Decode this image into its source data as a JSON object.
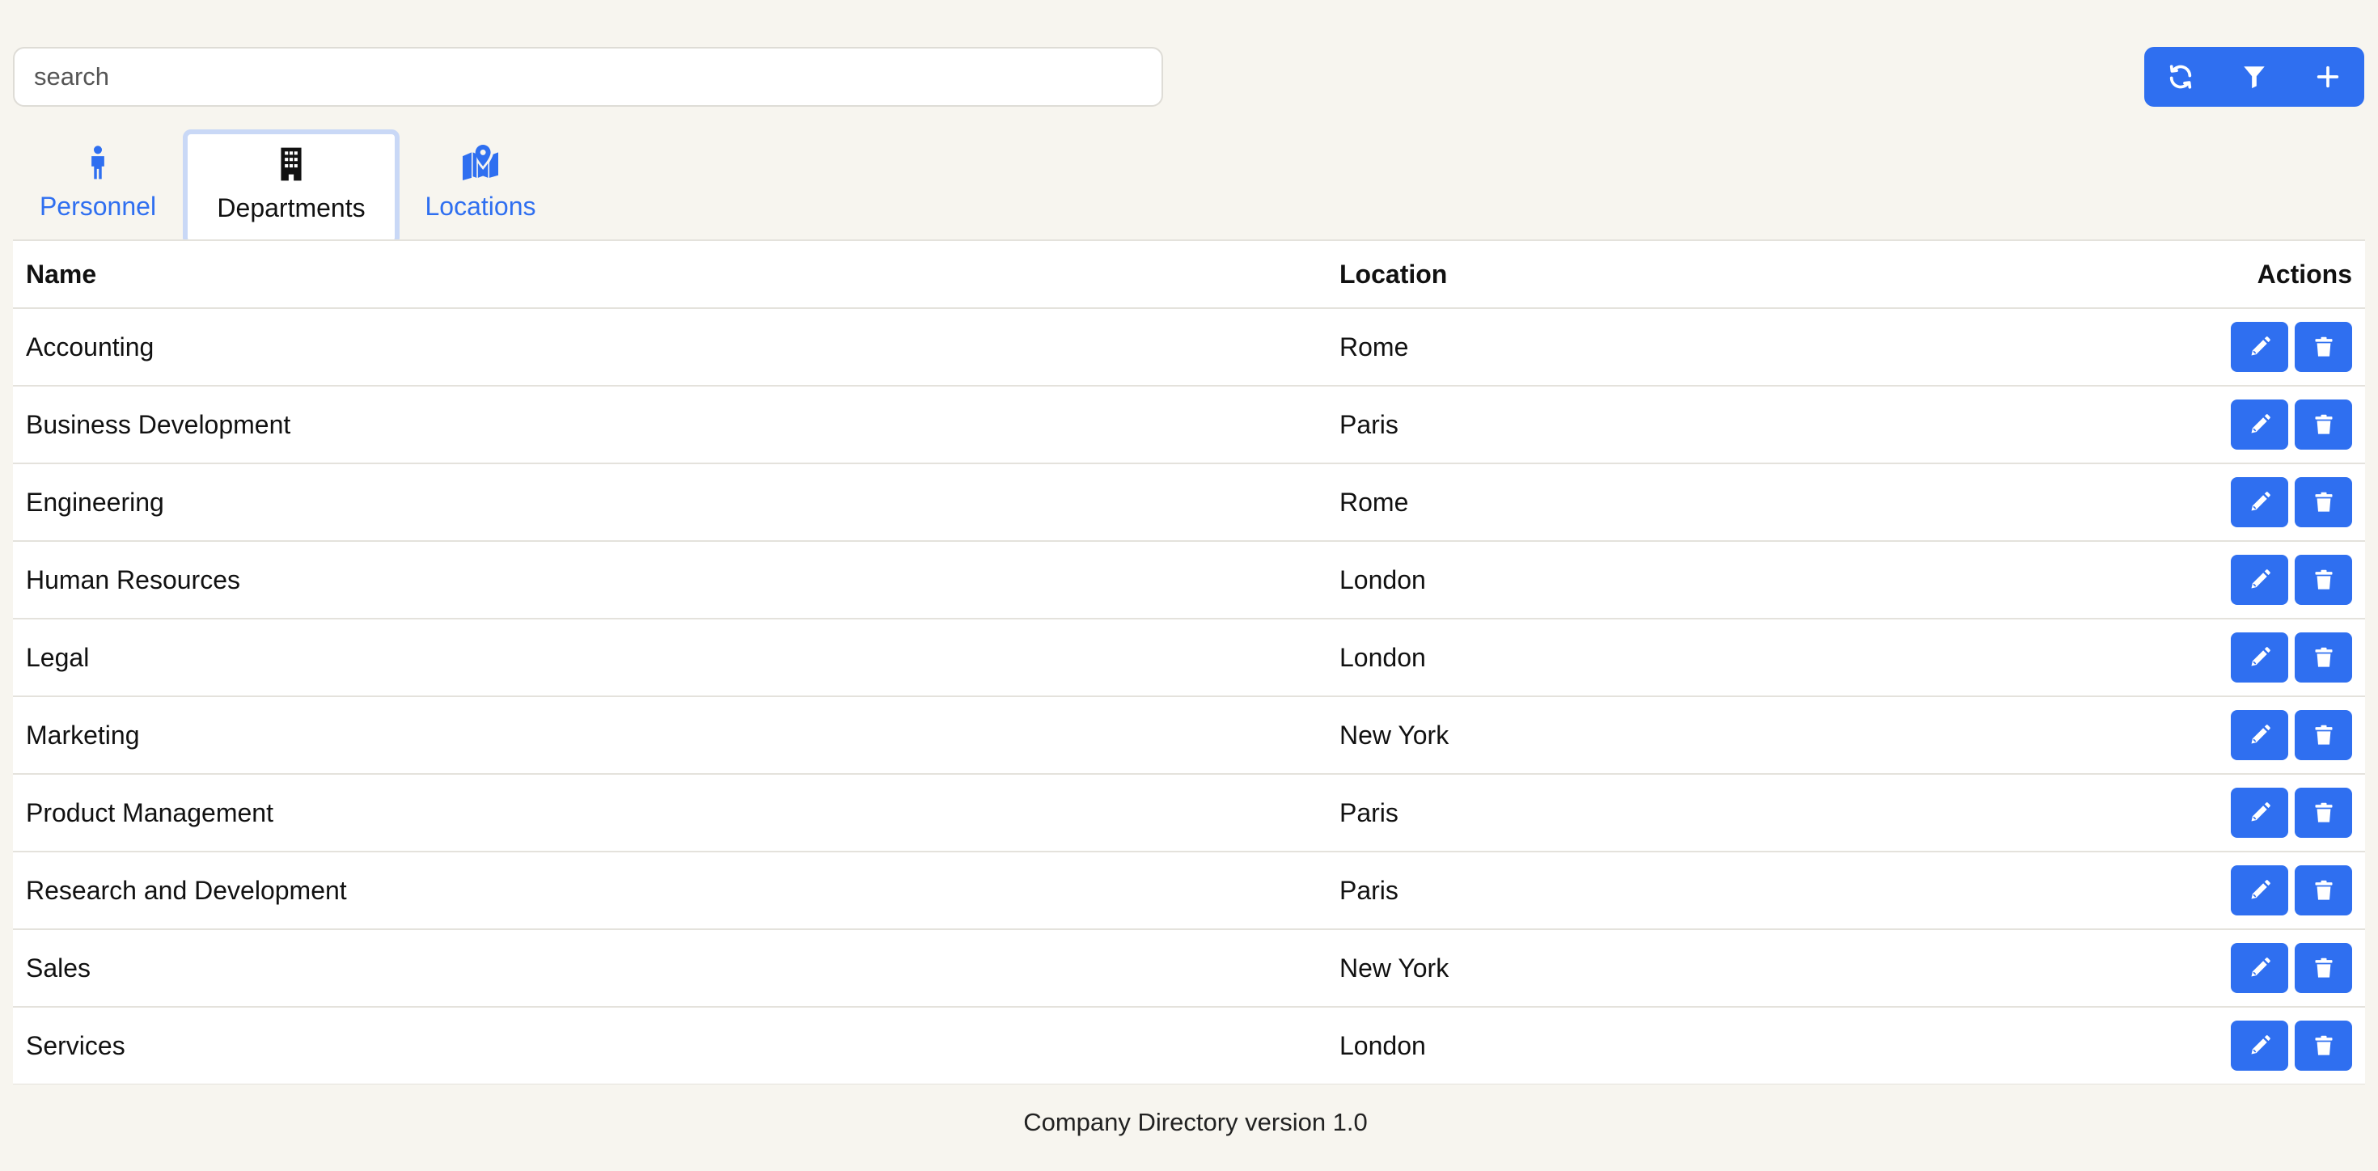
{
  "search": {
    "placeholder": "search",
    "value": ""
  },
  "toolbar": {
    "buttons": [
      {
        "icon": "refresh-icon"
      },
      {
        "icon": "filter-icon"
      },
      {
        "icon": "plus-icon"
      }
    ]
  },
  "tabs": [
    {
      "label": "Personnel",
      "icon": "person-icon",
      "active": false
    },
    {
      "label": "Departments",
      "icon": "building-icon",
      "active": true
    },
    {
      "label": "Locations",
      "icon": "map-icon",
      "active": false
    }
  ],
  "table": {
    "headers": {
      "name": "Name",
      "location": "Location",
      "actions": "Actions"
    },
    "rows": [
      {
        "name": "Accounting",
        "location": "Rome"
      },
      {
        "name": "Business Development",
        "location": "Paris"
      },
      {
        "name": "Engineering",
        "location": "Rome"
      },
      {
        "name": "Human Resources",
        "location": "London"
      },
      {
        "name": "Legal",
        "location": "London"
      },
      {
        "name": "Marketing",
        "location": "New York"
      },
      {
        "name": "Product Management",
        "location": "Paris"
      },
      {
        "name": "Research and Development",
        "location": "Paris"
      },
      {
        "name": "Sales",
        "location": "New York"
      },
      {
        "name": "Services",
        "location": "London"
      }
    ]
  },
  "footer": {
    "text": "Company Directory version 1.0"
  },
  "colors": {
    "accent": "#2f6ff0",
    "background": "#f7f5ef"
  }
}
